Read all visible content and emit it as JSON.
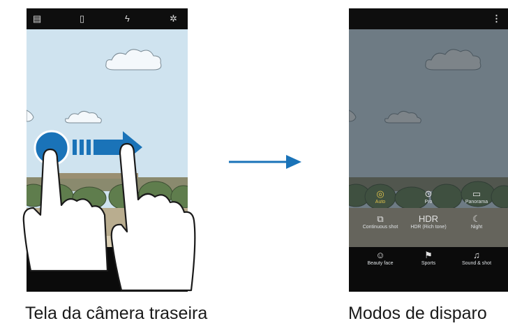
{
  "captions": {
    "left": "Tela da câmera traseira",
    "right": "Modos de disparo"
  },
  "camera_toolbar_icons": [
    "settings-icon",
    "switch-camera-icon",
    "flash-icon",
    "gear-icon"
  ],
  "shooting_modes": [
    {
      "icon": "auto-mode-icon",
      "label": "Auto",
      "selected": true
    },
    {
      "icon": "pro-mode-icon",
      "label": "Pro",
      "selected": false
    },
    {
      "icon": "panorama-icon",
      "label": "Panorama",
      "selected": false
    },
    {
      "icon": "continuous-shot-icon",
      "label": "Continuous shot",
      "selected": false
    },
    {
      "icon": "hdr-icon",
      "label": "HDR (Rich tone)",
      "selected": false
    },
    {
      "icon": "night-icon",
      "label": "Night",
      "selected": false
    },
    {
      "icon": "beauty-face-icon",
      "label": "Beauty face",
      "selected": false
    },
    {
      "icon": "sports-icon",
      "label": "Sports",
      "selected": false
    },
    {
      "icon": "sound-shot-icon",
      "label": "Sound & shot",
      "selected": false
    }
  ],
  "colors": {
    "sky": "#cfe3ef",
    "arrow": "#1a73b8",
    "selected_mode": "#e0c24a",
    "gesture_dot": "#1a73b8"
  }
}
